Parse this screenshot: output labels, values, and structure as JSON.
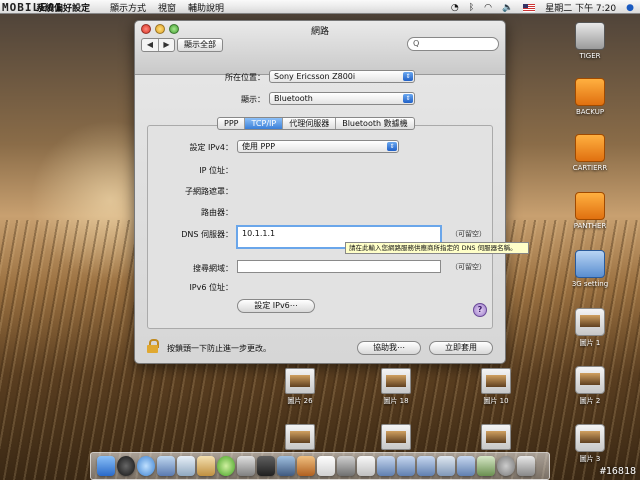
{
  "menubar": {
    "logo_text": "MOBILE01",
    "app_name": "系統偏好設定",
    "menus": [
      "顯示方式",
      "視窗",
      "輔助說明"
    ],
    "clock": "星期二 下午 7:20"
  },
  "window": {
    "title": "網路",
    "nav_back": "◀",
    "nav_forward": "▶",
    "show_all_label": "顯示全部",
    "search_placeholder": "Q"
  },
  "location": {
    "label": "所在位置：",
    "value": "Sony Ericsson Z800i"
  },
  "show": {
    "label": "顯示：",
    "value": "Bluetooth"
  },
  "tabs": [
    {
      "label": "PPP",
      "active": false
    },
    {
      "label": "TCP/IP",
      "active": true
    },
    {
      "label": "代理伺服器",
      "active": false
    },
    {
      "label": "Bluetooth 數據機",
      "active": false
    }
  ],
  "tcpip": {
    "configure_label": "設定 IPv4：",
    "configure_value": "使用 PPP",
    "ip_label": "IP 位址：",
    "subnet_label": "子網路遮罩：",
    "router_label": "路由器：",
    "dns_label": "DNS 伺服器：",
    "dns_value": "10.1.1.1",
    "dns_optional": "（可留空）",
    "search_domains_label": "搜尋網域：",
    "search_domains_value": "",
    "search_domains_optional": "（可留空）",
    "ipv6_label": "IPv6 位址：",
    "configure_ipv6_button": "設定 IPv6⋯",
    "help_button": "?"
  },
  "tooltip": "請在此輸入您網路服務供應商所指定的 DNS 伺服器名稱。",
  "footer": {
    "lock_text": "按鎖頭一下防止進一步更改。",
    "assist_button": "協助我⋯",
    "apply_button": "立即套用"
  },
  "desktop_icons": [
    {
      "label": "TIGER"
    },
    {
      "label": "BACKUP"
    },
    {
      "label": "CARTIERR"
    },
    {
      "label": "PANTHER"
    },
    {
      "label": "3G setting"
    },
    {
      "label": "圖片 1"
    },
    {
      "label": "圖片 2"
    },
    {
      "label": "圖片 3"
    }
  ],
  "desktop_files": [
    {
      "label": "圖片 26"
    },
    {
      "label": "圖片 18"
    },
    {
      "label": "圖片 10"
    }
  ],
  "watermark": "#16818",
  "colors": {
    "accent": "#3a7fd8",
    "tooltip_bg": "#ffffc8",
    "focus_ring": "#6aa6ea"
  }
}
